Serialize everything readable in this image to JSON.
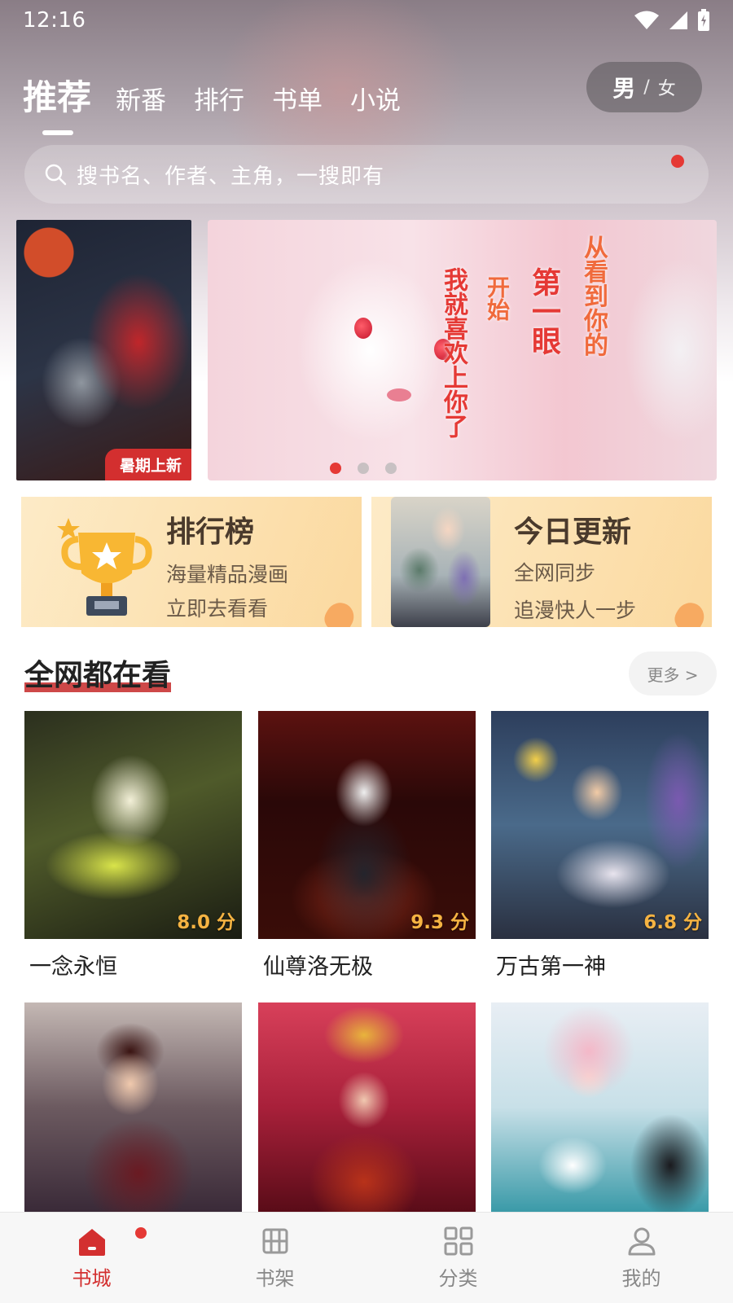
{
  "status_bar": {
    "time": "12:16"
  },
  "top_tabs": [
    {
      "label": "推荐",
      "active": true
    },
    {
      "label": "新番",
      "active": false
    },
    {
      "label": "排行",
      "active": false
    },
    {
      "label": "书单",
      "active": false
    },
    {
      "label": "小说",
      "active": false
    }
  ],
  "gender_toggle": {
    "male": "男",
    "separator": "/",
    "female": "女",
    "selected": "男"
  },
  "search": {
    "placeholder": "搜书名、作者、主角，一搜即有",
    "notification_dot": true
  },
  "banner": {
    "left_tag": "暑期上新",
    "main_text_col1": "从看到你的",
    "main_text_col2": "第一眼",
    "main_text_col3": "开始",
    "main_text_col4": "我就喜欢上你了",
    "dots": 3,
    "active_dot": 0
  },
  "quick_cards": {
    "ranking": {
      "title": "排行榜",
      "line1": "海量精品漫画",
      "line2": "立即去看看"
    },
    "today": {
      "title": "今日更新",
      "line1": "全网同步",
      "line2": "追漫快人一步"
    }
  },
  "section": {
    "title": "全网都在看",
    "more_label": "更多 >"
  },
  "books": [
    {
      "title": "一念永恒",
      "score": "8.0 分"
    },
    {
      "title": "仙尊洛无极",
      "score": "9.3 分"
    },
    {
      "title": "万古第一神",
      "score": "6.8 分"
    },
    {
      "title": "",
      "score": ""
    },
    {
      "title": "",
      "score": ""
    },
    {
      "title": "",
      "score": ""
    }
  ],
  "bottom_nav": [
    {
      "label": "书城",
      "icon": "home-icon",
      "active": true
    },
    {
      "label": "书架",
      "icon": "bookshelf-icon",
      "active": false
    },
    {
      "label": "分类",
      "icon": "category-icon",
      "active": false
    },
    {
      "label": "我的",
      "icon": "profile-icon",
      "active": false
    }
  ],
  "colors": {
    "accent": "#d32f2f",
    "score": "#f5b342"
  }
}
